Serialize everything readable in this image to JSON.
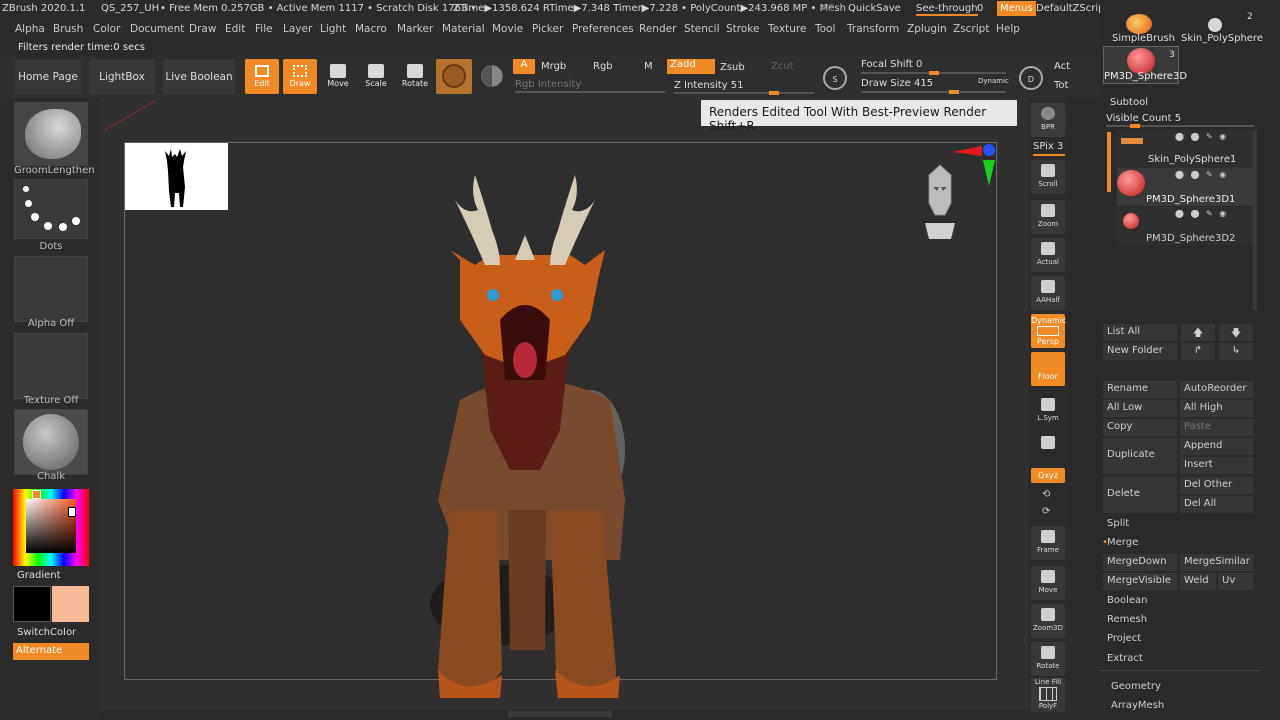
{
  "topbar": {
    "app": "ZBrush 2020.1.1",
    "doc": "QS_257_UH",
    "free_mem": "• Free Mem 0.257GB • Active Mem 1117 • Scratch Disk 1763 •",
    "ztime": "ZTime▶1358.624 RTime▶7.348 Timer▶7.228 • PolyCount▶243.968 MP • Mesh",
    "ac": "AC",
    "quicksave": "QuickSave",
    "see_through": "See-through",
    "see_through_val": "0",
    "menus": "Menus",
    "zscript": "DefaultZScript"
  },
  "menu": {
    "items": [
      "Alpha",
      "Brush",
      "Color",
      "Document",
      "Draw",
      "Edit",
      "File",
      "Layer",
      "Light",
      "Macro",
      "Marker",
      "Material",
      "Movie",
      "Picker",
      "Preferences",
      "Render",
      "Stencil",
      "Stroke",
      "Texture",
      "Tool",
      "Transform",
      "Zplugin",
      "Zscript",
      "Help"
    ]
  },
  "status": {
    "text": "Filters render time:0 secs"
  },
  "toolbar": {
    "home": "Home Page",
    "lightbox": "LightBox",
    "live_boolean": "Live Boolean",
    "edit": "Edit",
    "draw": "Draw",
    "move": "Move",
    "scale": "Scale",
    "rotate": "Rotate",
    "a": "A",
    "mrgb": "Mrgb",
    "rgb": "Rgb",
    "m": "M",
    "zadd": "Zadd",
    "zsub": "Zsub",
    "zcut": "Zcut",
    "rgb_intensity": "Rgb Intensity",
    "z_intensity": "Z Intensity 51",
    "focal_shift": "Focal Shift 0",
    "draw_size": "Draw Size 415",
    "dynamic": "Dynamic",
    "s": "S",
    "d": "D",
    "act": "Act",
    "tot": "Tot"
  },
  "left": {
    "groom": "GroomLengthen",
    "dots": "Dots",
    "alpha_off": "Alpha Off",
    "texture_off": "Texture Off",
    "chalk": "Chalk",
    "gradient": "Gradient",
    "switchcolor": "SwitchColor",
    "alternate": "Alternate",
    "secondary_color": "#f7b997",
    "primary_color": "#000000"
  },
  "tooltip": {
    "text": "Renders Edited Tool With Best-Preview Render  Shift+R"
  },
  "strip": {
    "bpr": "BPR",
    "spix": "SPix 3",
    "scroll": "Scroll",
    "zoom": "Zoom",
    "actual": "Actual",
    "aahalf": "AAHalf",
    "dynamic": "Dynamic",
    "persp": "Persp",
    "floor": "Floor",
    "lsym": "L.Sym",
    "xyz": "Qxyz",
    "frame": "Frame",
    "move": "Move",
    "zoom3d": "Zoom3D",
    "rotate": "Rotate",
    "linefill": "Line Fill",
    "polyf": "PolyF"
  },
  "right": {
    "tool1": "SimpleBrush",
    "tool2": "Skin_PolySphere",
    "tool2_count": "2",
    "tool3": "PM3D_Sphere3D",
    "tool3_count": "3",
    "subtool_header": "Subtool",
    "visible_count": "Visible Count 5",
    "subtools": [
      "Skin_PolySphere1",
      "PM3D_Sphere3D1",
      "PM3D_Sphere3D2"
    ],
    "list_all": "List All",
    "new_folder": "New Folder",
    "rename": "Rename",
    "autoreorder": "AutoReorder",
    "all_low": "All Low",
    "all_high": "All High",
    "copy": "Copy",
    "paste": "Paste",
    "duplicate": "Duplicate",
    "append": "Append",
    "insert": "Insert",
    "delete": "Delete",
    "del_other": "Del Other",
    "del_all": "Del All",
    "split": "Split",
    "merge": "Merge",
    "mergedown": "MergeDown",
    "mergesimilar": "MergeSimilar",
    "mergevisible": "MergeVisible",
    "weld": "Weld",
    "uv": "Uv",
    "boolean": "Boolean",
    "remesh": "Remesh",
    "project": "Project",
    "extract": "Extract",
    "geometry": "Geometry",
    "arraymesh": "ArrayMesh"
  },
  "colors": {
    "accent": "#f08a24",
    "canvas": "#303030",
    "panel": "#2b2b2b"
  }
}
